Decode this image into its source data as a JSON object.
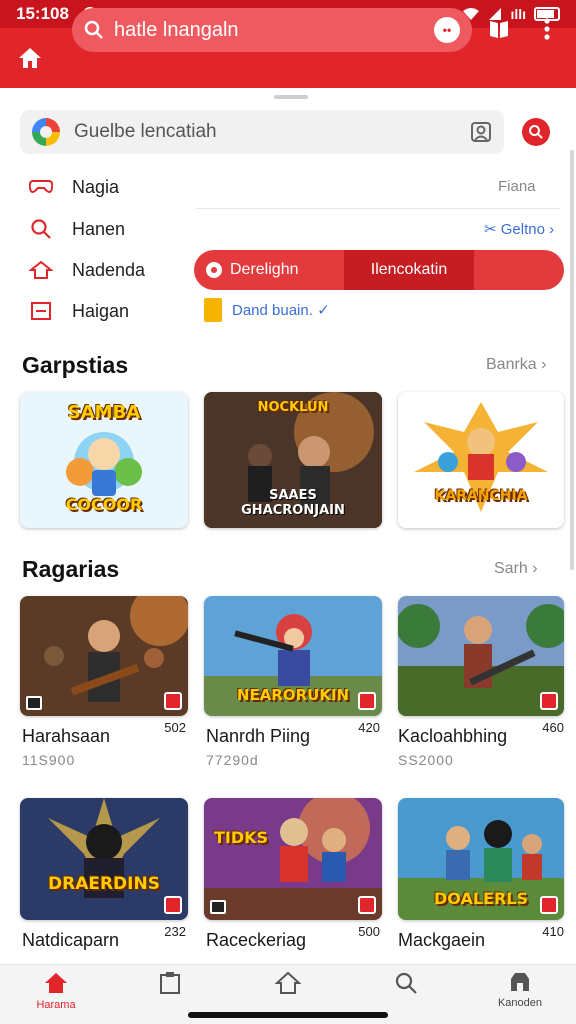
{
  "status_bar": {
    "time": "15:108",
    "battery_text": "ıllı"
  },
  "app_bar": {
    "search_text": "hatle lnangaln",
    "assistant_icon": "assistant-icon"
  },
  "search_card": {
    "placeholder": "Guelbe lencatiah"
  },
  "quick_menu": [
    {
      "label": "Nagia",
      "icon": "gamepad-icon"
    },
    {
      "label": "Hanen",
      "icon": "search-icon"
    },
    {
      "label": "Nadenda",
      "icon": "home-icon"
    },
    {
      "label": "Haigan",
      "icon": "calendar-icon"
    }
  ],
  "right_link_top": "Fiana",
  "right_link_blue": "Geltno",
  "segmented": {
    "left": "Derelighn",
    "middle": "Ilencokatin",
    "right": ""
  },
  "folder_link": "Dand buain.",
  "section1": {
    "title": "Garpstias",
    "see_all": "Banrka"
  },
  "section1_tiles": [
    {
      "caption_top": "SAMBA",
      "caption_bottom": "COCOOR"
    },
    {
      "caption_top": "NOCKLUN",
      "caption_bottom": "SAAES\nGHACRONJAIN"
    },
    {
      "caption_top": "KARANCHIA",
      "caption_bottom": ""
    }
  ],
  "section2": {
    "title": "Ragarias",
    "see_all": "Sarh"
  },
  "games": [
    {
      "name": "Harahsaan",
      "count": "502",
      "meta": "11S900",
      "caption": ""
    },
    {
      "name": "Nanrdh Piing",
      "count": "420",
      "meta": "77290d",
      "caption": "NEARORUKIN"
    },
    {
      "name": "Kacloahbhing",
      "count": "460",
      "meta": "SS2000",
      "caption": ""
    },
    {
      "name": "Natdicaparn",
      "count": "232",
      "meta": "",
      "caption": "DRAERDINS"
    },
    {
      "name": "Raceckeriag",
      "count": "500",
      "meta": "",
      "caption": "TIDKS"
    },
    {
      "name": "Mackgaein",
      "count": "410",
      "meta": "",
      "caption": "DOALERLS"
    }
  ],
  "bottom_nav": [
    {
      "label": "Harama",
      "icon": "home-icon",
      "active": true
    },
    {
      "label": "",
      "icon": "clipboard-icon",
      "active": false
    },
    {
      "label": "",
      "icon": "house-outline-icon",
      "active": false
    },
    {
      "label": "",
      "icon": "search-icon",
      "active": false
    },
    {
      "label": "Kanoden",
      "icon": "store-icon",
      "active": false
    }
  ],
  "colors": {
    "brand": "#e0252b",
    "link": "#3a6fd8"
  }
}
